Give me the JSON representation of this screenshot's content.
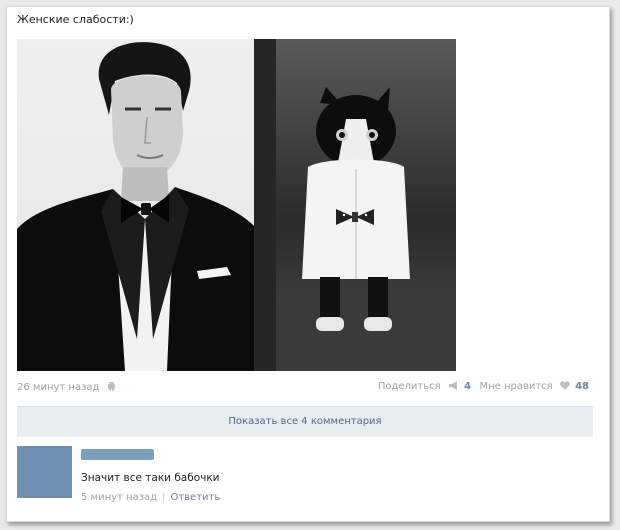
{
  "post": {
    "text": "Женские слабости:)",
    "images": [
      {
        "icon": "man-in-tuxedo-photo"
      },
      {
        "icon": "cat-in-shirt-with-bowtie-photo"
      }
    ],
    "time": "26 минут назад",
    "share_label": "Поделиться",
    "share_count": "4",
    "like_label": "Мне нравится",
    "like_count": "48"
  },
  "comments": {
    "show_all_label": "Показать все 4 комментария",
    "items": [
      {
        "author": "",
        "text": "Значит все таки бабочки",
        "time": "5 минут назад",
        "reply_label": "Ответить"
      }
    ]
  },
  "colors": {
    "link": "#6b85a3",
    "meta": "#9aa4ae",
    "comments_bar": "#e8edf2",
    "avatar": "#6e8faf"
  }
}
